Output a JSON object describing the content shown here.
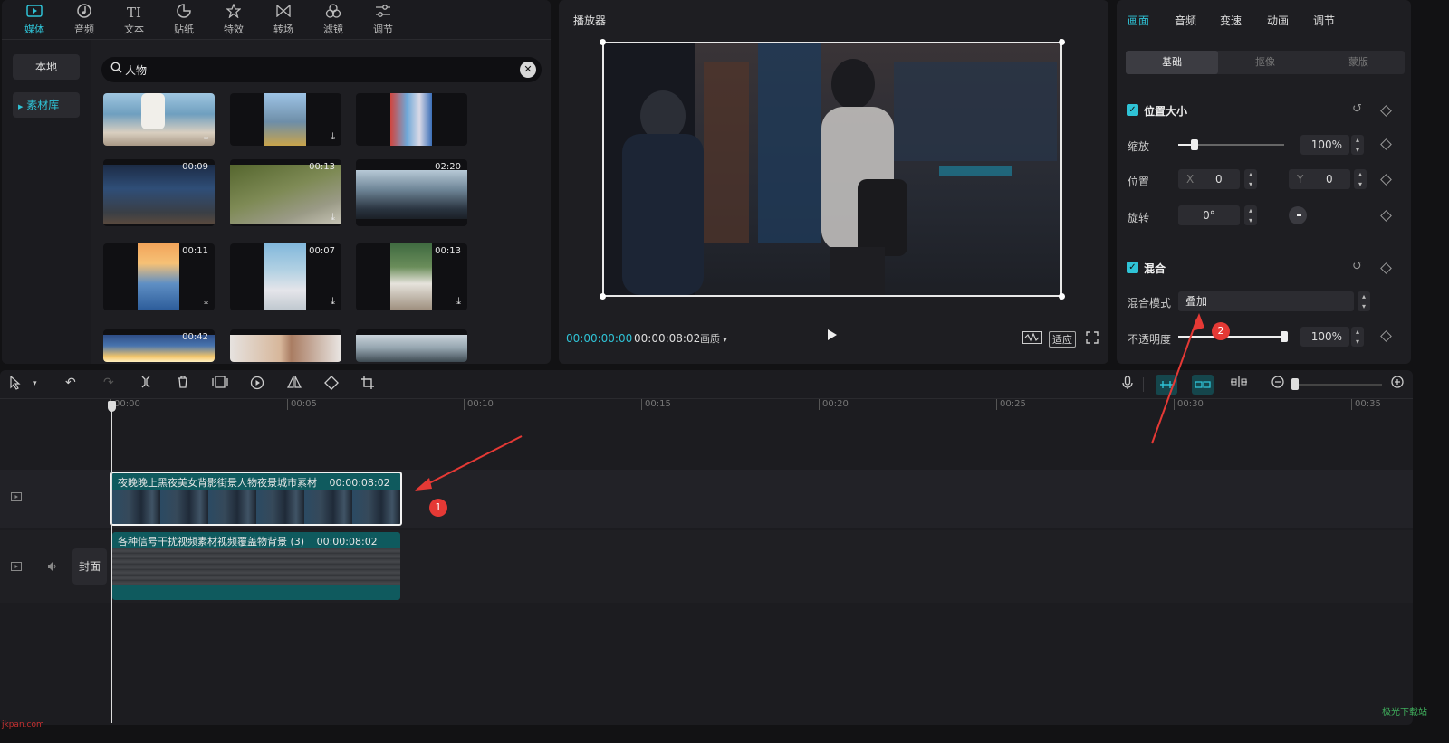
{
  "media_toolbar": {
    "tabs": [
      {
        "label": "媒体",
        "icon": "media-icon"
      },
      {
        "label": "音频",
        "icon": "audio-icon"
      },
      {
        "label": "文本",
        "icon": "text-icon"
      },
      {
        "label": "贴纸",
        "icon": "sticker-icon"
      },
      {
        "label": "特效",
        "icon": "effects-icon"
      },
      {
        "label": "转场",
        "icon": "transition-icon"
      },
      {
        "label": "滤镜",
        "icon": "filter-icon"
      },
      {
        "label": "调节",
        "icon": "adjust-icon"
      }
    ],
    "text_icon_glyph": "TI"
  },
  "media_nav": {
    "local": "本地",
    "library": "素材库"
  },
  "search": {
    "value": "人物"
  },
  "thumbnails": [
    {
      "duration": "",
      "download": true
    },
    {
      "duration": "",
      "download": true
    },
    {
      "duration": "",
      "download": false
    },
    {
      "duration": "00:09",
      "download": false
    },
    {
      "duration": "00:13",
      "download": true
    },
    {
      "duration": "02:20",
      "download": false
    },
    {
      "duration": "00:11",
      "download": true
    },
    {
      "duration": "00:07",
      "download": true
    },
    {
      "duration": "00:13",
      "download": true
    },
    {
      "duration": "00:42",
      "download": false
    },
    {
      "duration": "",
      "download": false
    },
    {
      "duration": "",
      "download": false
    }
  ],
  "player": {
    "title": "播放器",
    "current_time": "00:00:00:00",
    "total_time": "00:00:08:02",
    "quality": "画质",
    "fit_label": "适应"
  },
  "props": {
    "tabs": [
      "画面",
      "音频",
      "变速",
      "动画",
      "调节"
    ],
    "subtabs": [
      "基础",
      "抠像",
      "蒙版"
    ],
    "position_size": {
      "title": "位置大小",
      "scale_label": "缩放",
      "scale_value": "100%",
      "scale_level": 0.15,
      "position_label": "位置",
      "x_label": "X",
      "x_value": "0",
      "y_label": "Y",
      "y_value": "0",
      "rotate_label": "旋转",
      "rotate_value": "0°"
    },
    "blend": {
      "title": "混合",
      "mode_label": "混合模式",
      "mode_value": "叠加",
      "opacity_label": "不透明度",
      "opacity_value": "100%",
      "opacity_level": 1.0
    }
  },
  "timeline": {
    "ruler": [
      "00:00",
      "00:05",
      "00:10",
      "00:15",
      "00:20",
      "00:25",
      "00:30",
      "00:35"
    ],
    "clip1": {
      "title": "夜晚晚上黑夜美女背影街景人物夜景城市素材",
      "duration": "00:00:08:02"
    },
    "clip2": {
      "title": "各种信号干扰视频素材视频覆盖物背景 (3)",
      "duration": "00:00:08:02"
    },
    "cover_label": "封面"
  },
  "annotations": [
    "1",
    "2"
  ],
  "watermark": "极光下载站",
  "watermark_left": "jkpan.com",
  "colors": {
    "accent": "#2fc3d6",
    "clip": "#0f5a5e",
    "annotation": "#e53935"
  }
}
